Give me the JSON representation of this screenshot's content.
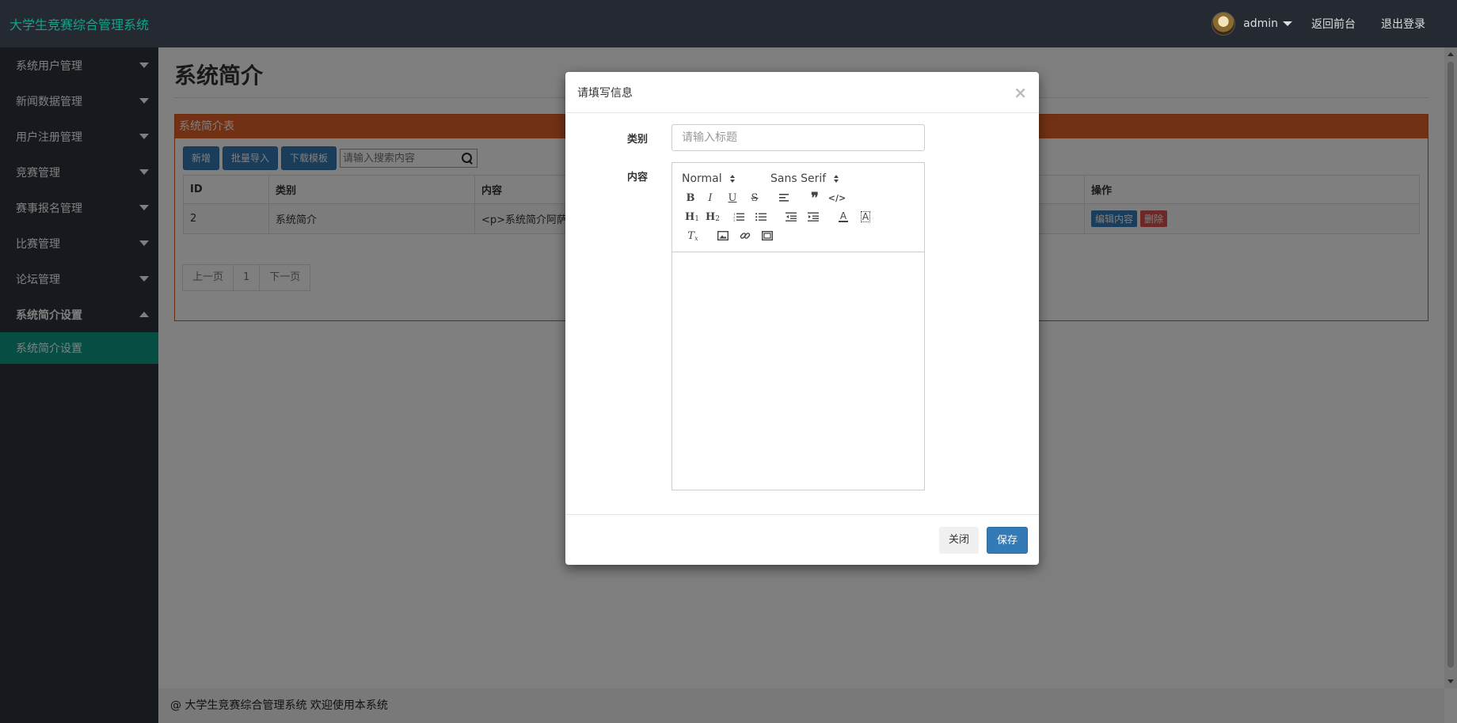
{
  "app": {
    "title": "大学生竞赛综合管理系统"
  },
  "header": {
    "user": "admin",
    "back_label": "返回前台",
    "logout_label": "退出登录"
  },
  "sidebar": {
    "items": [
      {
        "label": "系统用户管理"
      },
      {
        "label": "新闻数据管理"
      },
      {
        "label": "用户注册管理"
      },
      {
        "label": "竞赛管理"
      },
      {
        "label": "赛事报名管理"
      },
      {
        "label": "比赛管理"
      },
      {
        "label": "论坛管理"
      },
      {
        "label": "系统简介设置"
      }
    ],
    "active_sub": "系统简介设置"
  },
  "main": {
    "page_title": "系统简介",
    "panel_title": "系统简介表",
    "buttons": {
      "add": "新增",
      "import": "批量导入",
      "template": "下载模板"
    },
    "search_placeholder": "请输入搜索内容",
    "table": {
      "headers": {
        "id": "ID",
        "category": "类别",
        "content": "内容",
        "actions": "操作"
      },
      "rows": [
        {
          "id": "2",
          "category": "系统简介",
          "content": "<p>系统简介阿萨",
          "edit": "编辑内容",
          "delete": "删除"
        }
      ]
    },
    "pager": {
      "prev": "上一页",
      "page": "1",
      "next": "下一页"
    }
  },
  "footer": {
    "text": "@ 大学生竞赛综合管理系统 欢迎使用本系统"
  },
  "modal": {
    "title": "请填写信息",
    "close_icon": "×",
    "category_label": "类别",
    "category_placeholder": "请输入标题",
    "content_label": "内容",
    "editor": {
      "format_select": "Normal",
      "font_select": "Sans Serif",
      "buttons": [
        "B",
        "I",
        "U",
        "S",
        "align",
        "quote",
        "code",
        "H1",
        "H2",
        "ol",
        "ul",
        "outdent",
        "indent",
        "color",
        "bg",
        "clean",
        "image",
        "link",
        "video"
      ]
    },
    "close_label": "关闭",
    "save_label": "保存"
  },
  "colors": {
    "accent": "#14a28a",
    "panel": "#e4622a",
    "primary": "#337ab7",
    "danger": "#d9534f"
  }
}
